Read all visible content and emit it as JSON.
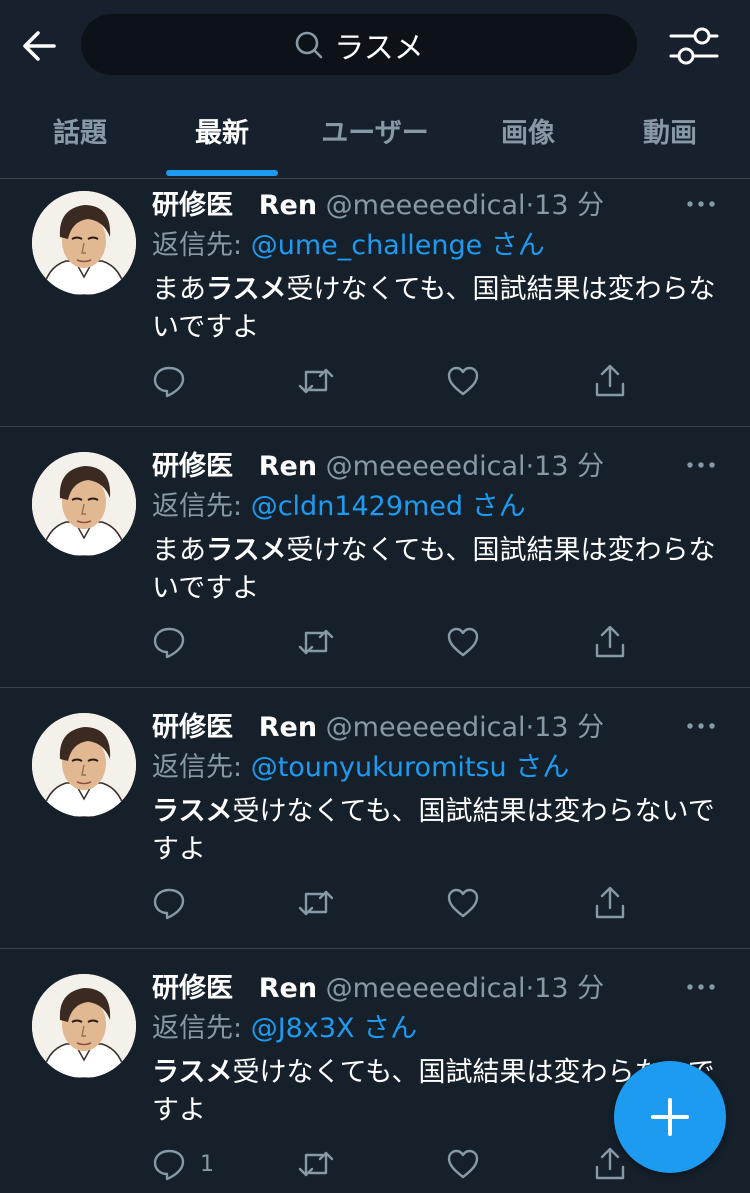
{
  "search": {
    "query": "ラスメ"
  },
  "tabs": [
    {
      "label": "話題"
    },
    {
      "label": "最新"
    },
    {
      "label": "ユーザー"
    },
    {
      "label": "画像"
    },
    {
      "label": "動画"
    }
  ],
  "active_tab": "最新",
  "colors": {
    "background": "#15202b",
    "accent": "#1d9bf0",
    "muted": "#8899a6",
    "divider": "#38444d"
  },
  "tweets": [
    {
      "display_name": "研修医",
      "display_name_en": "Ren",
      "handle": "@meeeeedical",
      "time": "13 分",
      "reply_prefix": "返信先:",
      "reply_to": "@ume_challenge",
      "reply_suffix": "さん",
      "text_pre": "まあ",
      "text_bold": "ラスメ",
      "text_post": "受けなくても、国試結果は変わらないですよ",
      "reply_count": ""
    },
    {
      "display_name": "研修医",
      "display_name_en": "Ren",
      "handle": "@meeeeedical",
      "time": "13 分",
      "reply_prefix": "返信先:",
      "reply_to": "@cldn1429med",
      "reply_suffix": "さん",
      "text_pre": "まあ",
      "text_bold": "ラスメ",
      "text_post": "受けなくても、国試結果は変わらないですよ",
      "reply_count": ""
    },
    {
      "display_name": "研修医",
      "display_name_en": "Ren",
      "handle": "@meeeeedical",
      "time": "13 分",
      "reply_prefix": "返信先:",
      "reply_to": "@tounyukuromitsu",
      "reply_suffix": "さん",
      "text_pre": "",
      "text_bold": "ラスメ",
      "text_post": "受けなくても、国試結果は変わらないですよ",
      "reply_count": ""
    },
    {
      "display_name": "研修医",
      "display_name_en": "Ren",
      "handle": "@meeeeedical",
      "time": "13 分",
      "reply_prefix": "返信先:",
      "reply_to": "@J8x3X",
      "reply_suffix": "さん",
      "text_pre": "",
      "text_bold": "ラスメ",
      "text_post": "受けなくても、国試結果は変わらないですよ",
      "reply_count": "1"
    }
  ],
  "icons": {
    "back": "arrow-left-icon",
    "search": "search-icon",
    "filter": "sliders-icon",
    "more": "more-icon",
    "reply": "reply-icon",
    "retweet": "retweet-icon",
    "like": "heart-icon",
    "share": "share-icon",
    "compose": "plus-icon"
  }
}
